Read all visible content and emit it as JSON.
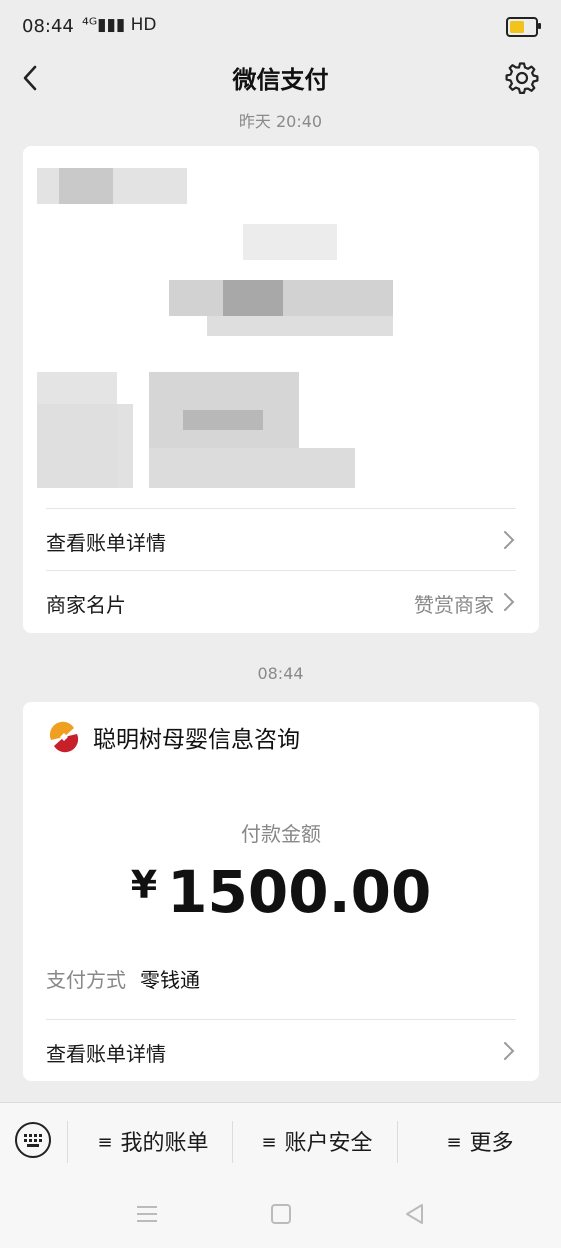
{
  "status_bar": {
    "time": "08:44",
    "network": "⁴ᴳ▮▮▮ HD",
    "battery_level": 0.6,
    "battery_color": "#f2c31a"
  },
  "nav": {
    "title": "微信支付",
    "back_icon": "back-arrow-icon",
    "settings_icon": "gear-icon"
  },
  "messages": [
    {
      "timestamp": "昨天 20:40",
      "content_blurred": true,
      "rows": [
        {
          "label": "查看账单详情",
          "right": ""
        },
        {
          "label": "商家名片",
          "right": "赞赏商家"
        }
      ]
    },
    {
      "timestamp": "08:44",
      "merchant": {
        "name": "聪明树母婴信息咨询",
        "logo_icon": "merchant-logo-icon"
      },
      "amount_label": "付款金额",
      "currency": "¥",
      "amount": "1500.00",
      "pay_method_label": "支付方式",
      "pay_method_value": "零钱通",
      "detail_label": "查看账单详情"
    }
  ],
  "menu": {
    "keyboard_icon": "keyboard-icon",
    "items": [
      {
        "label": "我的账单"
      },
      {
        "label": "账户安全"
      },
      {
        "label": "更多"
      }
    ]
  },
  "system_nav": [
    "menu-icon",
    "home-icon",
    "back-triangle-icon"
  ]
}
